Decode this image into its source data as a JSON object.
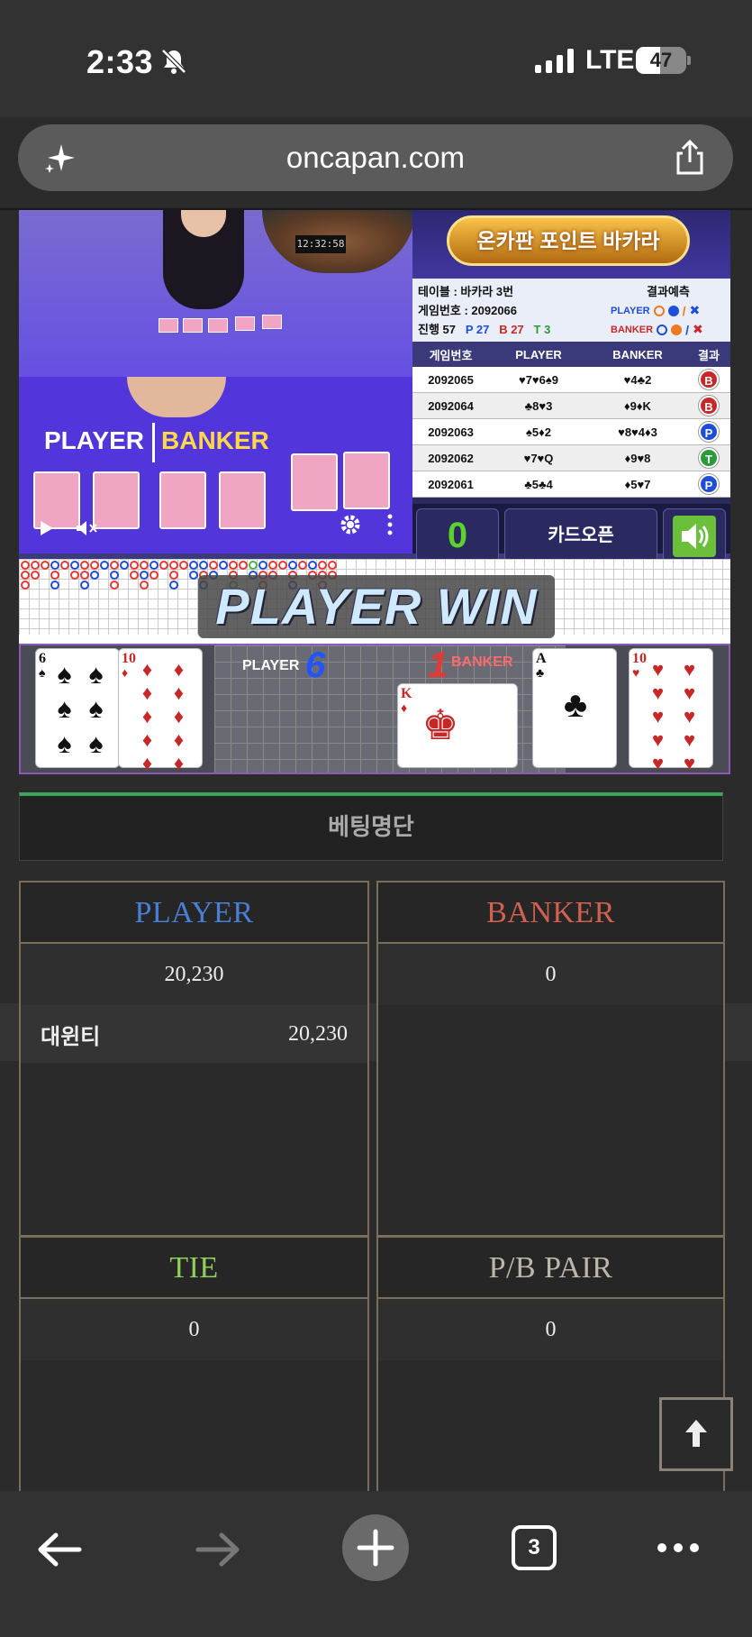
{
  "status": {
    "time": "2:33",
    "network": "LTE",
    "battery": "47"
  },
  "browser": {
    "url": "oncapan.com",
    "tab_count": "3"
  },
  "video": {
    "clock": "12:32:58",
    "felt_player": "PLAYER",
    "felt_banker": "BANKER"
  },
  "side": {
    "logo": "온카판 포인트 바카라",
    "table": "테이블 : 바카라 3번",
    "game_no": "게임번호 : 2092066",
    "progress": "진행 57",
    "p_count": "P 27",
    "b_count": "B 27",
    "t_count": "T 3",
    "predict_title": "결과예측",
    "predict_player": "PLAYER",
    "predict_banker": "BANKER",
    "headers": [
      "게임번호",
      "PLAYER",
      "BANKER",
      "결과"
    ],
    "history": [
      {
        "no": "2092065",
        "player": "♥7♥6♠9",
        "banker": "♥4♣2",
        "result": "B"
      },
      {
        "no": "2092064",
        "player": "♣8♥3",
        "banker": "♦9♦K",
        "result": "B"
      },
      {
        "no": "2092063",
        "player": "♠5♦2",
        "banker": "♥8♥4♦3",
        "result": "P"
      },
      {
        "no": "2092062",
        "player": "♥7♥Q",
        "banker": "♦9♥8",
        "result": "T"
      },
      {
        "no": "2092061",
        "player": "♣5♣4",
        "banker": "♦5♥7",
        "result": "P"
      }
    ],
    "count": "0",
    "card_open": "카드오픈"
  },
  "banner": "PLAYER WIN",
  "hand": {
    "player_label": "PLAYER",
    "player_score": "6",
    "banker_label": "BANKER",
    "banker_score": "1",
    "player_cards": [
      {
        "rank": "6",
        "suit": "♠"
      },
      {
        "rank": "10",
        "suit": "♦"
      }
    ],
    "banker_cards": [
      {
        "rank": "K",
        "suit": "♦"
      },
      {
        "rank": "A",
        "suit": "♣"
      },
      {
        "rank": "10",
        "suit": "♥"
      }
    ]
  },
  "betting": {
    "title": "베팅명단",
    "player": {
      "label": "PLAYER",
      "total": "20,230",
      "entries": [
        {
          "name": "대윈티",
          "amount": "20,230"
        }
      ]
    },
    "banker": {
      "label": "BANKER",
      "total": "0"
    },
    "tie": {
      "label": "TIE",
      "total": "0"
    },
    "pair": {
      "label": "P/B PAIR",
      "total": "0"
    }
  },
  "colors": {
    "player": "#4a7fd8",
    "banker": "#d0604f",
    "tie": "#8fcf5a",
    "pair": "#bdb6aa",
    "win": "#5dd22b"
  }
}
